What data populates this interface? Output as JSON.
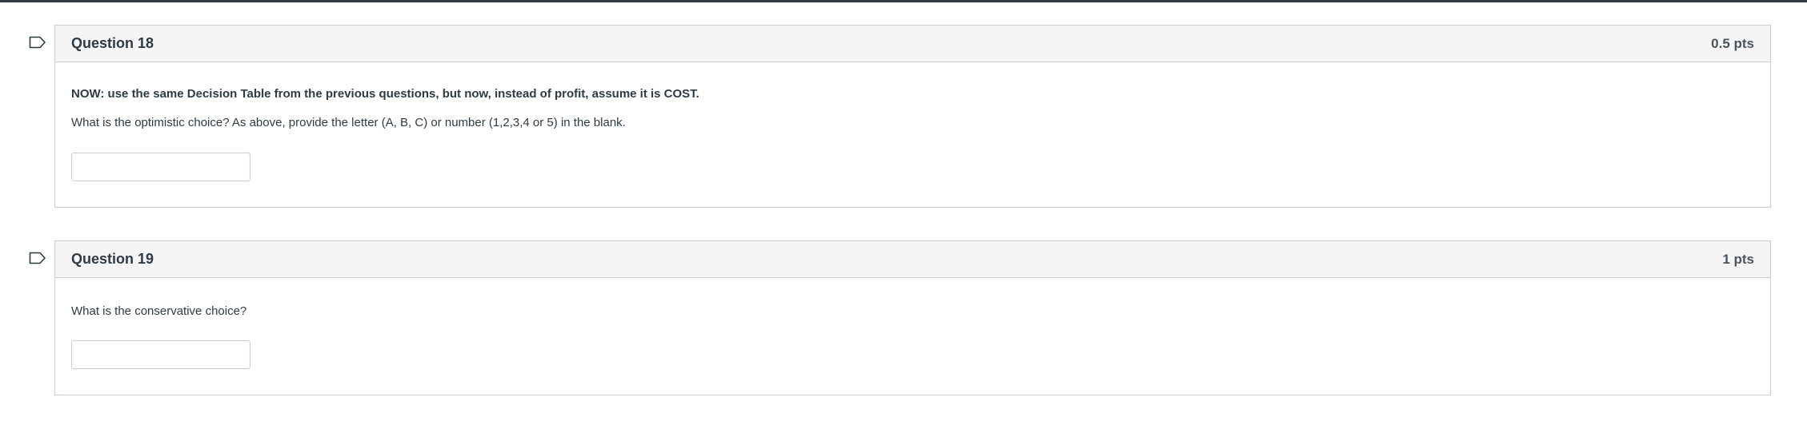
{
  "questions": [
    {
      "title": "Question 18",
      "points": "0.5 pts",
      "intro": "NOW: use the same Decision Table from the previous questions, but now, instead of profit, assume it is COST.",
      "text": "What is the optimistic choice? As above, provide the letter (A, B, C) or number (1,2,3,4 or 5) in the blank.",
      "answer_value": ""
    },
    {
      "title": "Question 19",
      "points": "1 pts",
      "text": "What is the conservative choice?",
      "answer_value": ""
    }
  ],
  "icons": {
    "flag": "flag-outline-icon"
  },
  "colors": {
    "text": "#2d3b45",
    "header_bg": "#f5f5f5",
    "border": "#c7cdd1"
  }
}
